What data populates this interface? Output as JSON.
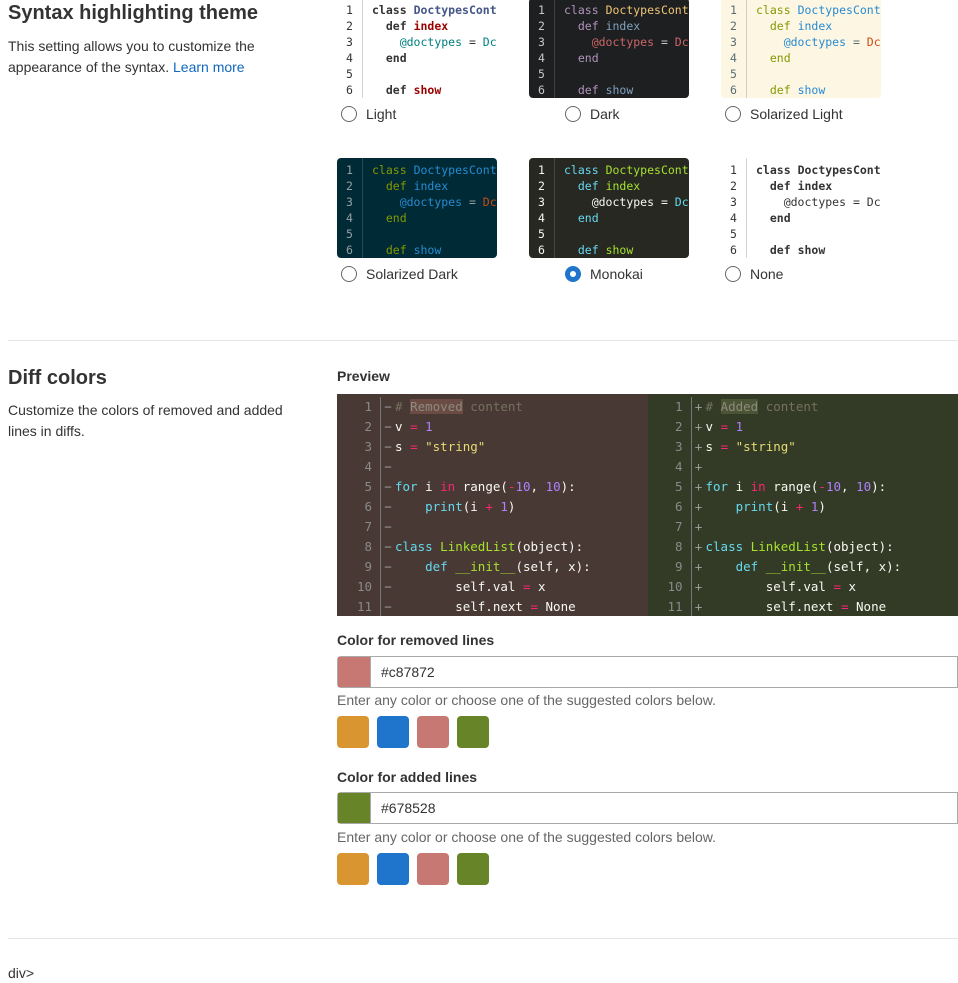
{
  "syntax": {
    "title": "Syntax highlighting theme",
    "description": "This setting allows you to customize the appearance of the syntax.",
    "learn_more": "Learn more",
    "code_lines": [
      [
        [
          "kw",
          "class"
        ],
        [
          "pl",
          " "
        ],
        [
          "cls",
          "DoctypesCont"
        ]
      ],
      [
        [
          "pl",
          "  "
        ],
        [
          "kw",
          "def"
        ],
        [
          "pl",
          " "
        ],
        [
          "fn",
          "index"
        ]
      ],
      [
        [
          "pl",
          "    "
        ],
        [
          "var",
          "@doctypes"
        ],
        [
          "pl",
          " = "
        ],
        [
          "const",
          "Dc"
        ]
      ],
      [
        [
          "pl",
          "  "
        ],
        [
          "kw",
          "end"
        ]
      ],
      [],
      [
        [
          "pl",
          "  "
        ],
        [
          "kw",
          "def"
        ],
        [
          "pl",
          " "
        ],
        [
          "fn",
          "show"
        ]
      ]
    ],
    "themes": [
      {
        "label": "Light",
        "cls": "t-light",
        "selected": false
      },
      {
        "label": "Dark",
        "cls": "t-dark",
        "selected": false
      },
      {
        "label": "Solarized Light",
        "cls": "t-sl",
        "selected": false
      },
      {
        "label": "Solarized Dark",
        "cls": "t-sd",
        "selected": false
      },
      {
        "label": "Monokai",
        "cls": "t-mk",
        "selected": true
      },
      {
        "label": "None",
        "cls": "t-none",
        "selected": false
      }
    ]
  },
  "diff": {
    "title": "Diff colors",
    "description": "Customize the colors of removed and added lines in diffs.",
    "preview_label": "Preview",
    "lines": [
      [
        [
          "c",
          "# "
        ],
        [
          "hlc",
          "Removed|Added"
        ],
        [
          "c",
          " content"
        ]
      ],
      [
        [
          "dc",
          "v "
        ],
        [
          "o",
          "="
        ],
        [
          "dc",
          " "
        ],
        [
          "n",
          "1"
        ]
      ],
      [
        [
          "dc",
          "s "
        ],
        [
          "o",
          "="
        ],
        [
          "dc",
          " "
        ],
        [
          "s",
          "\"string\""
        ]
      ],
      [],
      [
        [
          "k",
          "for"
        ],
        [
          "dc",
          " i "
        ],
        [
          "o",
          "in"
        ],
        [
          "dc",
          " range("
        ],
        [
          "o",
          "-"
        ],
        [
          "n",
          "10"
        ],
        [
          "dc",
          ", "
        ],
        [
          "n",
          "10"
        ],
        [
          "dc",
          "):"
        ]
      ],
      [
        [
          "dc",
          "    "
        ],
        [
          "k",
          "print"
        ],
        [
          "dc",
          "(i "
        ],
        [
          "o",
          "+"
        ],
        [
          "dc",
          " "
        ],
        [
          "n",
          "1"
        ],
        [
          "dc",
          ")"
        ]
      ],
      [],
      [
        [
          "k",
          "class"
        ],
        [
          "dc",
          " "
        ],
        [
          "f",
          "LinkedList"
        ],
        [
          "dc",
          "(object):"
        ]
      ],
      [
        [
          "dc",
          "    "
        ],
        [
          "k",
          "def"
        ],
        [
          "dc",
          " "
        ],
        [
          "f",
          "__init__"
        ],
        [
          "dc",
          "(self, x):"
        ]
      ],
      [
        [
          "dc",
          "        self.val "
        ],
        [
          "o",
          "="
        ],
        [
          "dc",
          " x"
        ]
      ],
      [
        [
          "dc",
          "        self.next "
        ],
        [
          "o",
          "="
        ],
        [
          "dc",
          " None"
        ]
      ]
    ],
    "removed": {
      "label": "Color for removed lines",
      "value": "#c87872",
      "sign": "−"
    },
    "added": {
      "label": "Color for added lines",
      "value": "#678528",
      "sign": "+"
    },
    "help": "Enter any color or choose one of the suggested colors below.",
    "suggested": [
      "#d99530",
      "#1f75cb",
      "#c87872",
      "#678528"
    ]
  },
  "footer": "div>"
}
